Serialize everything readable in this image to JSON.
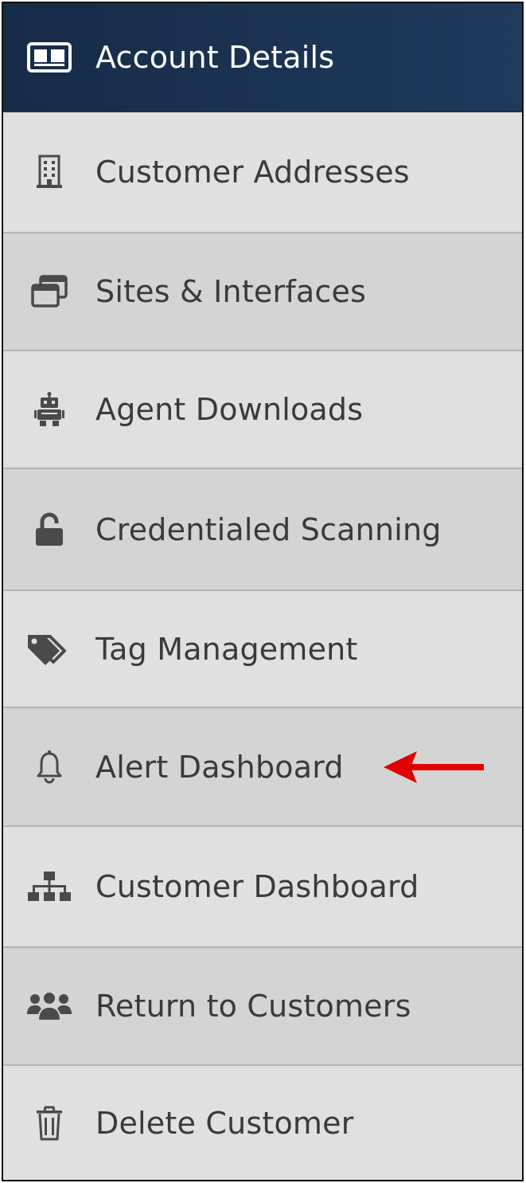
{
  "menu": {
    "items": [
      {
        "label": "Account Details",
        "icon": "id-card-icon",
        "active": true
      },
      {
        "label": "Customer Addresses",
        "icon": "building-icon"
      },
      {
        "label": "Sites & Interfaces",
        "icon": "windows-icon"
      },
      {
        "label": "Agent Downloads",
        "icon": "robot-icon"
      },
      {
        "label": "Credentialed Scanning",
        "icon": "unlock-icon"
      },
      {
        "label": "Tag Management",
        "icon": "tags-icon"
      },
      {
        "label": "Alert Dashboard",
        "icon": "bell-icon"
      },
      {
        "label": "Customer Dashboard",
        "icon": "sitemap-icon"
      },
      {
        "label": "Return to Customers",
        "icon": "users-icon"
      },
      {
        "label": "Delete Customer",
        "icon": "trash-icon"
      }
    ]
  },
  "colors": {
    "active_bg": "#1a3351",
    "item_light": "#e0e0e0",
    "item_dark": "#d4d4d4",
    "icon_gray": "#4a4a4a",
    "annotation_arrow": "#e00000"
  },
  "annotation": {
    "arrow_points_to": "Alert Dashboard"
  }
}
